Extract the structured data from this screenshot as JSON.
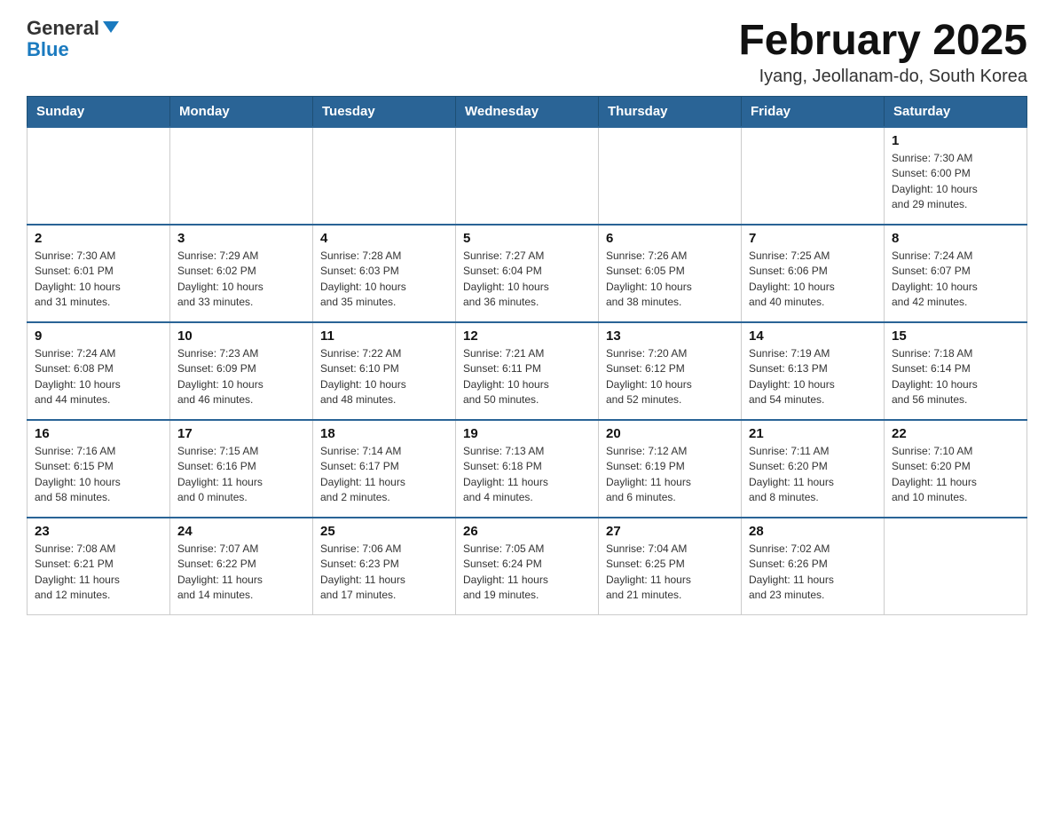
{
  "logo": {
    "general": "General",
    "blue": "Blue"
  },
  "title": "February 2025",
  "subtitle": "Iyang, Jeollanam-do, South Korea",
  "weekdays": [
    "Sunday",
    "Monday",
    "Tuesday",
    "Wednesday",
    "Thursday",
    "Friday",
    "Saturday"
  ],
  "weeks": [
    [
      {
        "day": "",
        "info": ""
      },
      {
        "day": "",
        "info": ""
      },
      {
        "day": "",
        "info": ""
      },
      {
        "day": "",
        "info": ""
      },
      {
        "day": "",
        "info": ""
      },
      {
        "day": "",
        "info": ""
      },
      {
        "day": "1",
        "info": "Sunrise: 7:30 AM\nSunset: 6:00 PM\nDaylight: 10 hours\nand 29 minutes."
      }
    ],
    [
      {
        "day": "2",
        "info": "Sunrise: 7:30 AM\nSunset: 6:01 PM\nDaylight: 10 hours\nand 31 minutes."
      },
      {
        "day": "3",
        "info": "Sunrise: 7:29 AM\nSunset: 6:02 PM\nDaylight: 10 hours\nand 33 minutes."
      },
      {
        "day": "4",
        "info": "Sunrise: 7:28 AM\nSunset: 6:03 PM\nDaylight: 10 hours\nand 35 minutes."
      },
      {
        "day": "5",
        "info": "Sunrise: 7:27 AM\nSunset: 6:04 PM\nDaylight: 10 hours\nand 36 minutes."
      },
      {
        "day": "6",
        "info": "Sunrise: 7:26 AM\nSunset: 6:05 PM\nDaylight: 10 hours\nand 38 minutes."
      },
      {
        "day": "7",
        "info": "Sunrise: 7:25 AM\nSunset: 6:06 PM\nDaylight: 10 hours\nand 40 minutes."
      },
      {
        "day": "8",
        "info": "Sunrise: 7:24 AM\nSunset: 6:07 PM\nDaylight: 10 hours\nand 42 minutes."
      }
    ],
    [
      {
        "day": "9",
        "info": "Sunrise: 7:24 AM\nSunset: 6:08 PM\nDaylight: 10 hours\nand 44 minutes."
      },
      {
        "day": "10",
        "info": "Sunrise: 7:23 AM\nSunset: 6:09 PM\nDaylight: 10 hours\nand 46 minutes."
      },
      {
        "day": "11",
        "info": "Sunrise: 7:22 AM\nSunset: 6:10 PM\nDaylight: 10 hours\nand 48 minutes."
      },
      {
        "day": "12",
        "info": "Sunrise: 7:21 AM\nSunset: 6:11 PM\nDaylight: 10 hours\nand 50 minutes."
      },
      {
        "day": "13",
        "info": "Sunrise: 7:20 AM\nSunset: 6:12 PM\nDaylight: 10 hours\nand 52 minutes."
      },
      {
        "day": "14",
        "info": "Sunrise: 7:19 AM\nSunset: 6:13 PM\nDaylight: 10 hours\nand 54 minutes."
      },
      {
        "day": "15",
        "info": "Sunrise: 7:18 AM\nSunset: 6:14 PM\nDaylight: 10 hours\nand 56 minutes."
      }
    ],
    [
      {
        "day": "16",
        "info": "Sunrise: 7:16 AM\nSunset: 6:15 PM\nDaylight: 10 hours\nand 58 minutes."
      },
      {
        "day": "17",
        "info": "Sunrise: 7:15 AM\nSunset: 6:16 PM\nDaylight: 11 hours\nand 0 minutes."
      },
      {
        "day": "18",
        "info": "Sunrise: 7:14 AM\nSunset: 6:17 PM\nDaylight: 11 hours\nand 2 minutes."
      },
      {
        "day": "19",
        "info": "Sunrise: 7:13 AM\nSunset: 6:18 PM\nDaylight: 11 hours\nand 4 minutes."
      },
      {
        "day": "20",
        "info": "Sunrise: 7:12 AM\nSunset: 6:19 PM\nDaylight: 11 hours\nand 6 minutes."
      },
      {
        "day": "21",
        "info": "Sunrise: 7:11 AM\nSunset: 6:20 PM\nDaylight: 11 hours\nand 8 minutes."
      },
      {
        "day": "22",
        "info": "Sunrise: 7:10 AM\nSunset: 6:20 PM\nDaylight: 11 hours\nand 10 minutes."
      }
    ],
    [
      {
        "day": "23",
        "info": "Sunrise: 7:08 AM\nSunset: 6:21 PM\nDaylight: 11 hours\nand 12 minutes."
      },
      {
        "day": "24",
        "info": "Sunrise: 7:07 AM\nSunset: 6:22 PM\nDaylight: 11 hours\nand 14 minutes."
      },
      {
        "day": "25",
        "info": "Sunrise: 7:06 AM\nSunset: 6:23 PM\nDaylight: 11 hours\nand 17 minutes."
      },
      {
        "day": "26",
        "info": "Sunrise: 7:05 AM\nSunset: 6:24 PM\nDaylight: 11 hours\nand 19 minutes."
      },
      {
        "day": "27",
        "info": "Sunrise: 7:04 AM\nSunset: 6:25 PM\nDaylight: 11 hours\nand 21 minutes."
      },
      {
        "day": "28",
        "info": "Sunrise: 7:02 AM\nSunset: 6:26 PM\nDaylight: 11 hours\nand 23 minutes."
      },
      {
        "day": "",
        "info": ""
      }
    ]
  ]
}
